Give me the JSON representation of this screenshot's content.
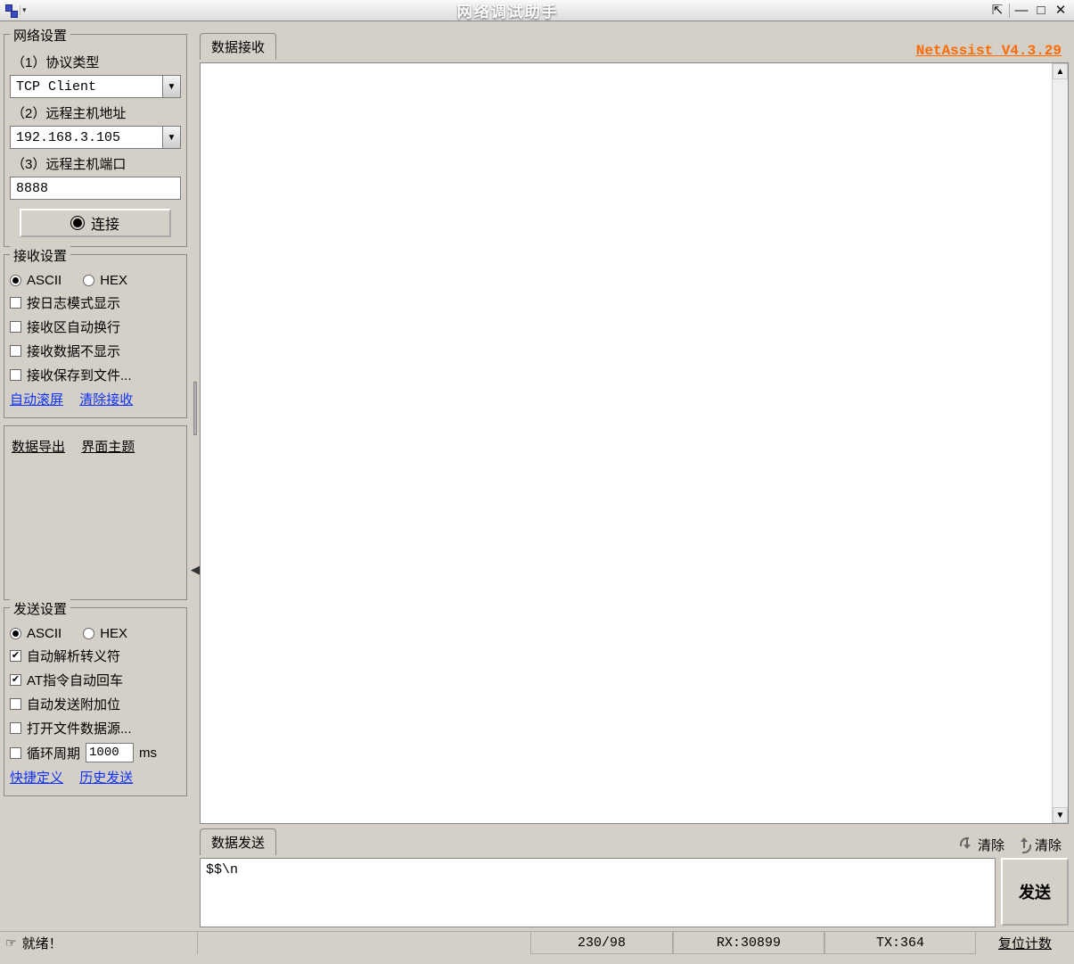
{
  "titlebar": {
    "title": "网络调试助手"
  },
  "version_label": "NetAssist  V4.3.29",
  "sidebar": {
    "network": {
      "group_title": "网络设置",
      "protocol_label": "（1）协议类型",
      "protocol_value": "TCP Client",
      "host_label": "（2）远程主机地址",
      "host_value": "192.168.3.105",
      "port_label": "（3）远程主机端口",
      "port_value": "8888",
      "connect_label": "连接"
    },
    "recv": {
      "group_title": "接收设置",
      "radio_ascii": "ASCII",
      "radio_hex": "HEX",
      "chk_log": "按日志模式显示",
      "chk_wrap": "接收区自动换行",
      "chk_hide": "接收数据不显示",
      "chk_save": "接收保存到文件...",
      "link_autoscroll": "自动滚屏",
      "link_clearrecv": "清除接收"
    },
    "extra": {
      "link_export": "数据导出",
      "link_theme": "界面主题"
    },
    "send": {
      "group_title": "发送设置",
      "radio_ascii": "ASCII",
      "radio_hex": "HEX",
      "chk_escape": "自动解析转义符",
      "chk_atcr": "AT指令自动回车",
      "chk_append": "自动发送附加位",
      "chk_filesrc": "打开文件数据源...",
      "chk_cycle": "循环周期",
      "cycle_value": "1000",
      "cycle_unit": "ms",
      "link_shortcut": "快捷定义",
      "link_history": "历史发送"
    }
  },
  "main": {
    "tab_recv": "数据接收",
    "tab_send": "数据发送",
    "clear_down": "清除",
    "clear_up": "清除",
    "send_button": "发送",
    "send_text": "$$\\n"
  },
  "statusbar": {
    "ready": "就绪！",
    "counts": "230/98",
    "rx": "RX:30899",
    "tx": "TX:364",
    "reset": "复位计数"
  }
}
